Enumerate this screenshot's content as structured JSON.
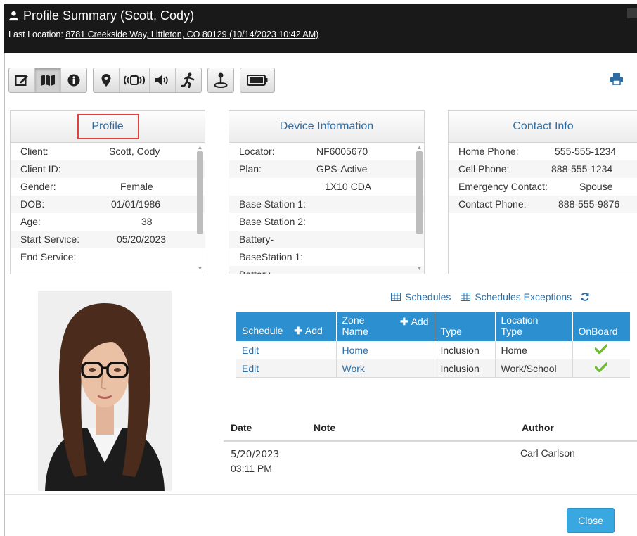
{
  "header": {
    "title": "Profile Summary (Scott, Cody)",
    "last_location_label": "Last Location:",
    "last_location_value": "8781 Creekside Way, Littleton, CO 80129 (10/14/2023 10:42 AM)"
  },
  "toolbar": {
    "group1": [
      "edit-icon",
      "map-icon",
      "info-icon"
    ],
    "group2": [
      "map-marker-icon",
      "vibrate-icon",
      "volume-icon",
      "running-icon"
    ],
    "group3": [
      "pin-on-map-icon"
    ],
    "group4": [
      "battery-icon"
    ],
    "print_icon": "print-icon"
  },
  "profile": {
    "title": "Profile",
    "rows": [
      {
        "label": "Client:",
        "value": "Scott, Cody"
      },
      {
        "label": "Client ID:",
        "value": ""
      },
      {
        "label": "Gender:",
        "value": "Female"
      },
      {
        "label": "DOB:",
        "value": "01/01/1986"
      },
      {
        "label": "Age:",
        "value": "38"
      },
      {
        "label": "Start Service:",
        "value": "05/20/2023"
      },
      {
        "label": "End Service:",
        "value": ""
      }
    ]
  },
  "device": {
    "title": "Device Information",
    "rows": [
      {
        "label": "Locator:",
        "value": "NF6005670"
      },
      {
        "label": "Plan:",
        "value": "GPS-Active"
      },
      {
        "label": "",
        "value": "1X10 CDA"
      },
      {
        "label": "Base Station 1:",
        "value": ""
      },
      {
        "label": "Base Station 2:",
        "value": ""
      },
      {
        "label": "Battery-",
        "value": ""
      },
      {
        "label": "BaseStation 1:",
        "value": ""
      },
      {
        "label": "Battery-",
        "value": ""
      }
    ]
  },
  "contact": {
    "title": "Contact Info",
    "rows": [
      {
        "label": "Home Phone:",
        "value": "555-555-1234"
      },
      {
        "label": "Cell Phone:",
        "value": "888-555-1234"
      },
      {
        "label": "Emergency Contact:",
        "value": "Spouse"
      },
      {
        "label": "Contact Phone:",
        "value": "888-555-9876"
      }
    ]
  },
  "schedule_links": {
    "schedules": "Schedules",
    "exceptions": "Schedules Exceptions"
  },
  "schedule_table": {
    "headers": {
      "schedule": "Schedule",
      "add1": "Add",
      "zone_line1": "Zone",
      "zone_line2": "Name",
      "add2": "Add",
      "type": "Type",
      "loc_line1": "Location",
      "loc_line2": "Type",
      "onboard": "OnBoard"
    },
    "rows": [
      {
        "schedule": "Edit",
        "zone": "Home",
        "type": "Inclusion",
        "location_type": "Home",
        "onboard": true
      },
      {
        "schedule": "Edit",
        "zone": "Work",
        "type": "Inclusion",
        "location_type": "Work/School",
        "onboard": true
      }
    ]
  },
  "notes": {
    "headers": {
      "date": "Date",
      "note": "Note",
      "author": "Author"
    },
    "rows": [
      {
        "date": "5/20/2023",
        "time": "03:11 PM",
        "note": "",
        "author": "Carl Carlson"
      }
    ]
  },
  "footer": {
    "close_label": "Close"
  },
  "colors": {
    "title_bg": "#191919",
    "accent": "#2c8fd0",
    "link": "#2e6da4",
    "highlight": "#e04040",
    "check": "#6fbe2e"
  }
}
